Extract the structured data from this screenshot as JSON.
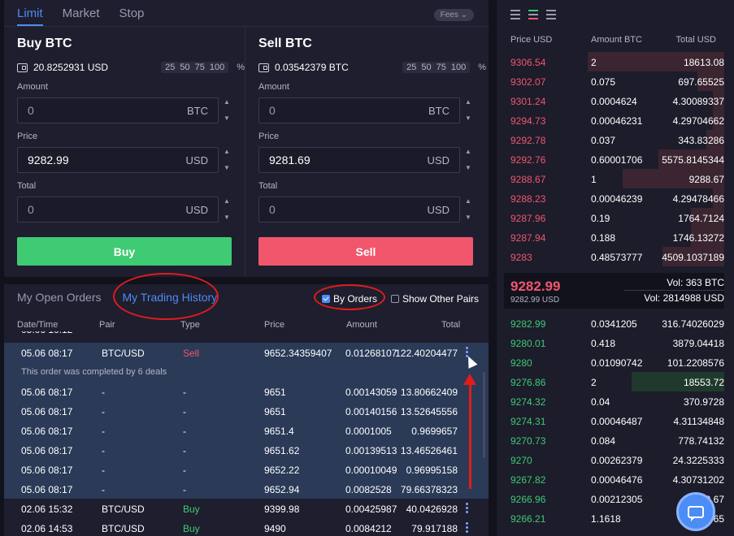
{
  "order_form": {
    "tabs": [
      {
        "label": "Limit"
      },
      {
        "label": "Market"
      },
      {
        "label": "Stop"
      }
    ],
    "fees_label": "Fees",
    "percent_options": [
      "25",
      "50",
      "75",
      "100"
    ],
    "percent_sign": "%",
    "buy": {
      "title": "Buy BTC",
      "balance": "20.8252931 USD",
      "amount_label": "Amount",
      "amount_value": "0",
      "amount_unit": "BTC",
      "price_label": "Price",
      "price_value": "9282.99",
      "price_unit": "USD",
      "total_label": "Total",
      "total_value": "0",
      "total_unit": "USD",
      "button_label": "Buy"
    },
    "sell": {
      "title": "Sell BTC",
      "balance": "0.03542379 BTC",
      "amount_label": "Amount",
      "amount_value": "0",
      "amount_unit": "BTC",
      "price_label": "Price",
      "price_value": "9281.69",
      "price_unit": "USD",
      "total_label": "Total",
      "total_value": "0",
      "total_unit": "USD",
      "button_label": "Sell"
    }
  },
  "history": {
    "tabs": [
      {
        "label": "My Open Orders"
      },
      {
        "label": "My Trading History"
      }
    ],
    "by_orders_label": "By Orders",
    "show_other_pairs_label": "Show Other Pairs",
    "columns": [
      "Date/Time",
      "Pair",
      "Type",
      "Price",
      "Amount",
      "Total"
    ],
    "rows": [
      {
        "date": "05.06 08:17",
        "pair": "BTC/USD",
        "type": "Sell",
        "price": "9652.34359407",
        "amount": "0.01268107",
        "total": "122.40204477"
      },
      {
        "note": "This order was completed by 6 deals"
      },
      {
        "date": "05.06 08:17",
        "pair": "-",
        "type": "-",
        "price": "9651",
        "amount": "0.00143059",
        "total": "13.80662409"
      },
      {
        "date": "05.06 08:17",
        "pair": "-",
        "type": "-",
        "price": "9651",
        "amount": "0.00140156",
        "total": "13.52645556"
      },
      {
        "date": "05.06 08:17",
        "pair": "-",
        "type": "-",
        "price": "9651.4",
        "amount": "0.0001005",
        "total": "0.9699657"
      },
      {
        "date": "05.06 08:17",
        "pair": "-",
        "type": "-",
        "price": "9651.62",
        "amount": "0.00139513",
        "total": "13.46526461"
      },
      {
        "date": "05.06 08:17",
        "pair": "-",
        "type": "-",
        "price": "9652.22",
        "amount": "0.00010049",
        "total": "0.96995158"
      },
      {
        "date": "05.06 08:17",
        "pair": "-",
        "type": "-",
        "price": "9652.94",
        "amount": "0.0082528",
        "total": "79.66378323"
      },
      {
        "date": "02.06 15:32",
        "pair": "BTC/USD",
        "type": "Buy",
        "price": "9399.98",
        "amount": "0.00425987",
        "total": "40.0426928"
      },
      {
        "date": "02.06 14:53",
        "pair": "BTC/USD",
        "type": "Buy",
        "price": "9490",
        "amount": "0.0084212",
        "total": "79.917188"
      }
    ]
  },
  "order_book": {
    "columns": [
      "Price USD",
      "Amount BTC",
      "Total USD"
    ],
    "asks": [
      {
        "price": "9306.54",
        "amount": "2",
        "total": "18613.08",
        "depth": 0.62
      },
      {
        "price": "9302.07",
        "amount": "0.075",
        "total": "697.65525",
        "depth": 0.12
      },
      {
        "price": "9301.24",
        "amount": "0.0004624",
        "total": "4.30089337",
        "depth": 0.05
      },
      {
        "price": "9294.73",
        "amount": "0.00046231",
        "total": "4.29704662",
        "depth": 0.05
      },
      {
        "price": "9292.78",
        "amount": "0.037",
        "total": "343.83286",
        "depth": 0.08
      },
      {
        "price": "9292.76",
        "amount": "0.60001706",
        "total": "5575.8145344",
        "depth": 0.3
      },
      {
        "price": "9288.67",
        "amount": "1",
        "total": "9288.67",
        "depth": 0.46
      },
      {
        "price": "9288.23",
        "amount": "0.00046239",
        "total": "4.29478466",
        "depth": 0.05
      },
      {
        "price": "9287.96",
        "amount": "0.19",
        "total": "1764.7124",
        "depth": 0.15
      },
      {
        "price": "9287.94",
        "amount": "0.188",
        "total": "1746.13272",
        "depth": 0.15
      },
      {
        "price": "9283",
        "amount": "0.48573777",
        "total": "4509.1037189",
        "depth": 0.28
      }
    ],
    "mid_price": "9282.99",
    "mid_price_usd": "9282.99 USD",
    "vol_btc": "Vol: 363 BTC",
    "vol_usd": "Vol: 2814988 USD",
    "bids": [
      {
        "price": "9282.99",
        "amount": "0.0341205",
        "total": "316.74026029",
        "depth": 0.0
      },
      {
        "price": "9280.01",
        "amount": "0.418",
        "total": "3879.04418",
        "depth": 0.0
      },
      {
        "price": "9280",
        "amount": "0.01090742",
        "total": "101.2208576",
        "depth": 0.0
      },
      {
        "price": "9276.86",
        "amount": "2",
        "total": "18553.72",
        "depth": 0.42
      },
      {
        "price": "9274.32",
        "amount": "0.04",
        "total": "370.9728",
        "depth": 0.0
      },
      {
        "price": "9274.31",
        "amount": "0.00046487",
        "total": "4.31134848",
        "depth": 0.0
      },
      {
        "price": "9270.73",
        "amount": "0.084",
        "total": "778.74132",
        "depth": 0.0
      },
      {
        "price": "9270",
        "amount": "0.00262379",
        "total": "24.3225333",
        "depth": 0.0
      },
      {
        "price": "9267.82",
        "amount": "0.00046476",
        "total": "4.30731202",
        "depth": 0.0
      },
      {
        "price": "9266.96",
        "amount": "0.00212305",
        "total": "19.67",
        "depth": 0.0
      },
      {
        "price": "9266.21",
        "amount": "1.1618",
        "total": "10765",
        "depth": 0.0
      }
    ]
  }
}
